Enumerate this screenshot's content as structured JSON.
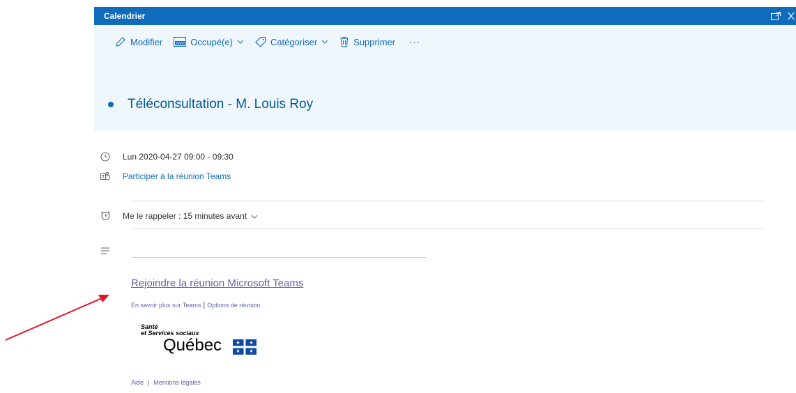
{
  "window": {
    "title": "Calendrier"
  },
  "toolbar": {
    "edit_label": "Modifier",
    "status_label": "Occupé(e)",
    "categorize_label": "Catégoriser",
    "delete_label": "Supprimer",
    "more_label": "···"
  },
  "event": {
    "title": "Téléconsultation - M. Louis Roy",
    "datetime": "Lun 2020-04-27 09:00 - 09:30",
    "teams_link": "Participer à la réunion Teams",
    "reminder": "Me le rappeler : 15 minutes avant"
  },
  "body": {
    "join_link": "Rejoindre la réunion Microsoft Teams",
    "learn_more": "En savoir plus sur Teams",
    "separator": "|",
    "meeting_options": "Options de réunion",
    "logo": {
      "line1": "Santé",
      "line2": "et Services sociaux",
      "line3": "Québec"
    },
    "help": "Aide",
    "legal_separator": "|",
    "legal": "Mentions légales"
  },
  "colors": {
    "accent": "#0f6cbd",
    "header_bg": "#eff6fc",
    "teams_link": "#6264a7",
    "annotation_arrow": "#e81123"
  }
}
